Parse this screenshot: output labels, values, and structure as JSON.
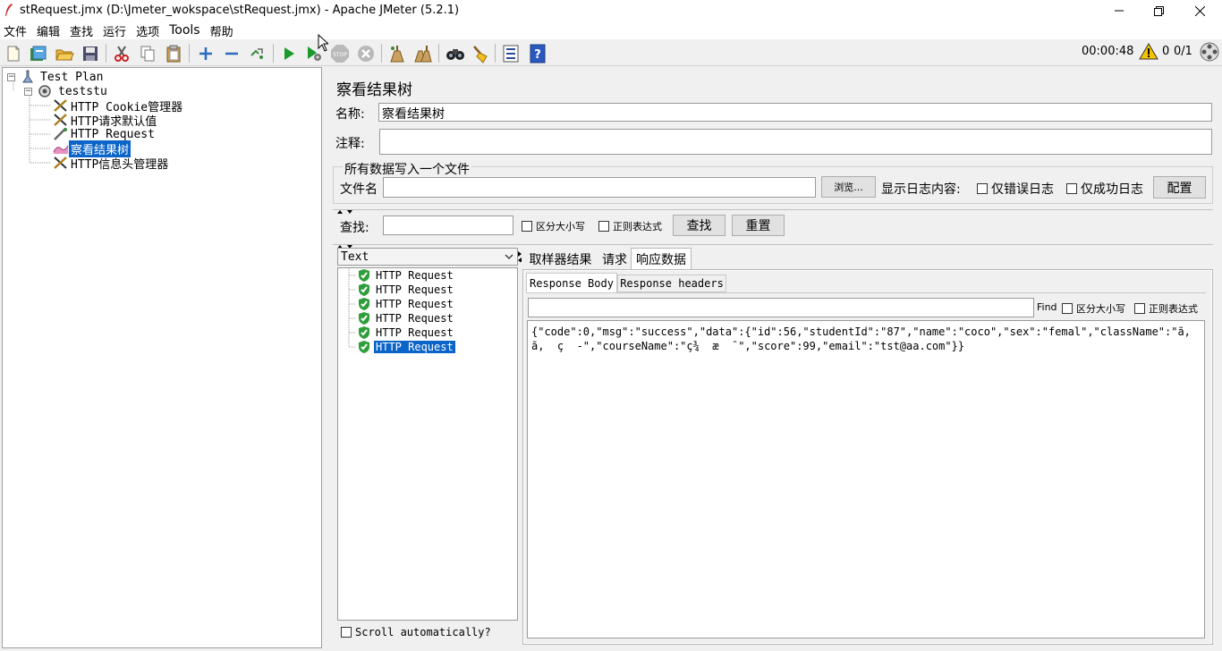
{
  "window": {
    "title": "stRequest.jmx (D:\\Jmeter_wokspace\\stRequest.jmx) - Apache JMeter (5.2.1)"
  },
  "menu": [
    "文件",
    "编辑",
    "查找",
    "运行",
    "选项",
    "Tools",
    "帮助"
  ],
  "toolbar": {
    "icons": [
      "new-icon",
      "templates-icon",
      "open-icon",
      "save-icon",
      "cut-icon",
      "copy-icon",
      "paste-icon",
      "expand-icon",
      "collapse-icon",
      "toggle-icon",
      "start-icon",
      "start-no-pause-icon",
      "stop-icon",
      "shutdown-icon",
      "clear-icon",
      "clear-all-icon",
      "search-icon",
      "reset-search-icon",
      "function-helper-icon",
      "help-icon"
    ],
    "timer": "00:00:48",
    "warnings": "0",
    "threads": "0/1"
  },
  "tree": {
    "root": "Test Plan",
    "thread_group": "teststu",
    "children": [
      "HTTP Cookie管理器",
      "HTTP请求默认值",
      "HTTP Request",
      "察看结果树",
      "HTTP信息头管理器"
    ],
    "selected_index": 3
  },
  "panel": {
    "title": "察看结果树",
    "name_label": "名称:",
    "name_value": "察看结果树",
    "comment_label": "注释:",
    "comment_value": "",
    "file_group_title": "所有数据写入一个文件",
    "file_label": "文件名",
    "file_value": "",
    "browse_button": "浏览...",
    "log_content_label": "显示日志内容:",
    "errors_only": "仅错误日志",
    "success_only": "仅成功日志",
    "configure_button": "配置",
    "search_label": "查找:",
    "search_value": "",
    "case_sensitive": "区分大小写",
    "regex": "正则表达式",
    "find_button": "查找",
    "reset_button": "重置"
  },
  "results": {
    "renderer": "Text",
    "samples": [
      "HTTP Request",
      "HTTP Request",
      "HTTP Request",
      "HTTP Request",
      "HTTP Request",
      "HTTP Request"
    ],
    "selected_index": 5,
    "scroll_auto": "Scroll automatically?"
  },
  "detail": {
    "tabs": [
      "取样器结果",
      "请求",
      "响应数据"
    ],
    "active_tab": 2,
    "subtabs": [
      "Response Body",
      "Response headers"
    ],
    "active_subtab": 0,
    "find_label": "Find",
    "find_case": "区分大小写",
    "find_regex": "正则表达式",
    "body_line1": "{\"code\":0,\"msg\":\"success\",\"data\":{\"id\":56,\"studentId\":\"87\",\"name\":\"coco\",\"sex\":\"femal\",\"className\":\"ã,  å¹´",
    "body_line2": "ã,  ç  -\",\"courseName\":\"ç¾  æ  ¯\",\"score\":99,\"email\":\"tst@aa.com\"}}"
  },
  "colors": {
    "selection": "#0b64c8",
    "start_green": "#1a9a2a",
    "check_green": "#2e9e3a"
  }
}
